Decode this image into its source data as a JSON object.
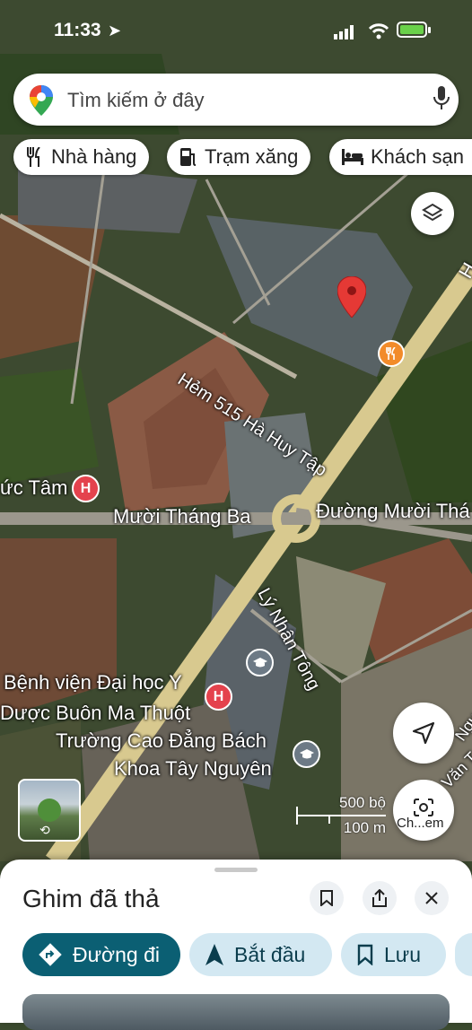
{
  "status_bar": {
    "time": "11:33"
  },
  "search": {
    "placeholder": "Tìm kiếm ở đây"
  },
  "chips": [
    {
      "label": "Nhà hàng",
      "icon": "restaurant-icon"
    },
    {
      "label": "Trạm xăng",
      "icon": "gas-station-icon"
    },
    {
      "label": "Khách sạn",
      "icon": "hotel-icon"
    }
  ],
  "map_labels": {
    "street_hem": "Hẻm 515 Hà Huy Tập",
    "street_muoi_thang_ba_w": "Mười Tháng Ba",
    "street_muoi_thang_ba_e": "Đường Mười Thá",
    "street_ly_nhan_tong": "Lý Nhân Tông",
    "hospital_west": "ức Tâm",
    "hospital_bv_line1": "Bệnh viện Đại học Y",
    "hospital_bv_line2": "Dược Buôn Ma Thuột",
    "school_line1": "Trường Cao Đẳng Bách",
    "school_line2": "Khoa Tây Nguyên",
    "edge_east_1": "H",
    "edge_east_2": "Ngu",
    "edge_east_3": "Văn T"
  },
  "scale": {
    "imperial": "500 bộ",
    "metric": "100 m"
  },
  "controls": {
    "lens_label": "Ch...em"
  },
  "sheet": {
    "title": "Ghim đã thả",
    "actions": [
      {
        "label": "Đường đi",
        "icon": "directions-icon",
        "primary": true
      },
      {
        "label": "Bắt đầu",
        "icon": "navigation-arrow-icon",
        "primary": false
      },
      {
        "label": "Lưu",
        "icon": "bookmark-icon",
        "primary": false
      }
    ]
  },
  "colors": {
    "accent": "#0b57d0",
    "primary_btn": "#0b5f73",
    "secondary_btn": "#d3e8f2",
    "pin_red": "#e53935",
    "hospital_red": "#e4424d"
  }
}
